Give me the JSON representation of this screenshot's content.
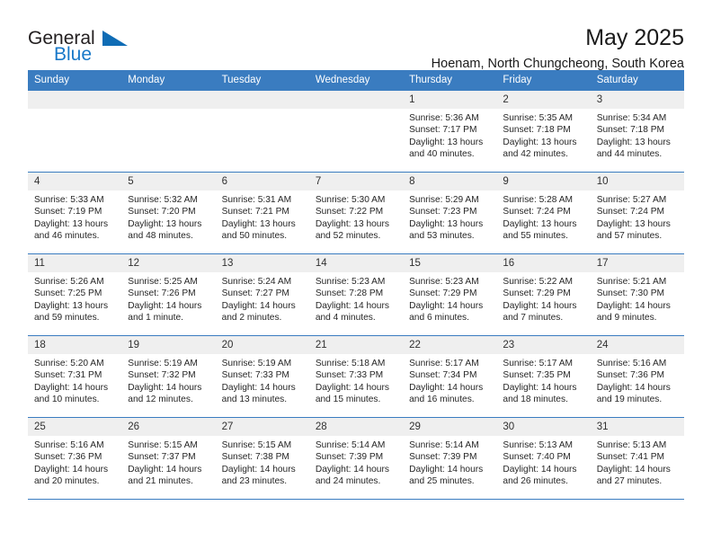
{
  "brand": {
    "name_top": "General",
    "name_bottom": "Blue",
    "accent_color": "#1878c8",
    "triangle_color": "#0f6cb5"
  },
  "header": {
    "title": "May 2025",
    "subtitle": "Hoenam, North Chungcheong, South Korea"
  },
  "calendar": {
    "header_bg": "#3a7cc0",
    "daynum_bg": "#efefef",
    "weekday_labels": [
      "Sunday",
      "Monday",
      "Tuesday",
      "Wednesday",
      "Thursday",
      "Friday",
      "Saturday"
    ],
    "weeks": [
      [
        {
          "day": "",
          "lines": []
        },
        {
          "day": "",
          "lines": []
        },
        {
          "day": "",
          "lines": []
        },
        {
          "day": "",
          "lines": []
        },
        {
          "day": "1",
          "lines": [
            "Sunrise: 5:36 AM",
            "Sunset: 7:17 PM",
            "Daylight: 13 hours",
            "and 40 minutes."
          ]
        },
        {
          "day": "2",
          "lines": [
            "Sunrise: 5:35 AM",
            "Sunset: 7:18 PM",
            "Daylight: 13 hours",
            "and 42 minutes."
          ]
        },
        {
          "day": "3",
          "lines": [
            "Sunrise: 5:34 AM",
            "Sunset: 7:18 PM",
            "Daylight: 13 hours",
            "and 44 minutes."
          ]
        }
      ],
      [
        {
          "day": "4",
          "lines": [
            "Sunrise: 5:33 AM",
            "Sunset: 7:19 PM",
            "Daylight: 13 hours",
            "and 46 minutes."
          ]
        },
        {
          "day": "5",
          "lines": [
            "Sunrise: 5:32 AM",
            "Sunset: 7:20 PM",
            "Daylight: 13 hours",
            "and 48 minutes."
          ]
        },
        {
          "day": "6",
          "lines": [
            "Sunrise: 5:31 AM",
            "Sunset: 7:21 PM",
            "Daylight: 13 hours",
            "and 50 minutes."
          ]
        },
        {
          "day": "7",
          "lines": [
            "Sunrise: 5:30 AM",
            "Sunset: 7:22 PM",
            "Daylight: 13 hours",
            "and 52 minutes."
          ]
        },
        {
          "day": "8",
          "lines": [
            "Sunrise: 5:29 AM",
            "Sunset: 7:23 PM",
            "Daylight: 13 hours",
            "and 53 minutes."
          ]
        },
        {
          "day": "9",
          "lines": [
            "Sunrise: 5:28 AM",
            "Sunset: 7:24 PM",
            "Daylight: 13 hours",
            "and 55 minutes."
          ]
        },
        {
          "day": "10",
          "lines": [
            "Sunrise: 5:27 AM",
            "Sunset: 7:24 PM",
            "Daylight: 13 hours",
            "and 57 minutes."
          ]
        }
      ],
      [
        {
          "day": "11",
          "lines": [
            "Sunrise: 5:26 AM",
            "Sunset: 7:25 PM",
            "Daylight: 13 hours",
            "and 59 minutes."
          ]
        },
        {
          "day": "12",
          "lines": [
            "Sunrise: 5:25 AM",
            "Sunset: 7:26 PM",
            "Daylight: 14 hours",
            "and 1 minute."
          ]
        },
        {
          "day": "13",
          "lines": [
            "Sunrise: 5:24 AM",
            "Sunset: 7:27 PM",
            "Daylight: 14 hours",
            "and 2 minutes."
          ]
        },
        {
          "day": "14",
          "lines": [
            "Sunrise: 5:23 AM",
            "Sunset: 7:28 PM",
            "Daylight: 14 hours",
            "and 4 minutes."
          ]
        },
        {
          "day": "15",
          "lines": [
            "Sunrise: 5:23 AM",
            "Sunset: 7:29 PM",
            "Daylight: 14 hours",
            "and 6 minutes."
          ]
        },
        {
          "day": "16",
          "lines": [
            "Sunrise: 5:22 AM",
            "Sunset: 7:29 PM",
            "Daylight: 14 hours",
            "and 7 minutes."
          ]
        },
        {
          "day": "17",
          "lines": [
            "Sunrise: 5:21 AM",
            "Sunset: 7:30 PM",
            "Daylight: 14 hours",
            "and 9 minutes."
          ]
        }
      ],
      [
        {
          "day": "18",
          "lines": [
            "Sunrise: 5:20 AM",
            "Sunset: 7:31 PM",
            "Daylight: 14 hours",
            "and 10 minutes."
          ]
        },
        {
          "day": "19",
          "lines": [
            "Sunrise: 5:19 AM",
            "Sunset: 7:32 PM",
            "Daylight: 14 hours",
            "and 12 minutes."
          ]
        },
        {
          "day": "20",
          "lines": [
            "Sunrise: 5:19 AM",
            "Sunset: 7:33 PM",
            "Daylight: 14 hours",
            "and 13 minutes."
          ]
        },
        {
          "day": "21",
          "lines": [
            "Sunrise: 5:18 AM",
            "Sunset: 7:33 PM",
            "Daylight: 14 hours",
            "and 15 minutes."
          ]
        },
        {
          "day": "22",
          "lines": [
            "Sunrise: 5:17 AM",
            "Sunset: 7:34 PM",
            "Daylight: 14 hours",
            "and 16 minutes."
          ]
        },
        {
          "day": "23",
          "lines": [
            "Sunrise: 5:17 AM",
            "Sunset: 7:35 PM",
            "Daylight: 14 hours",
            "and 18 minutes."
          ]
        },
        {
          "day": "24",
          "lines": [
            "Sunrise: 5:16 AM",
            "Sunset: 7:36 PM",
            "Daylight: 14 hours",
            "and 19 minutes."
          ]
        }
      ],
      [
        {
          "day": "25",
          "lines": [
            "Sunrise: 5:16 AM",
            "Sunset: 7:36 PM",
            "Daylight: 14 hours",
            "and 20 minutes."
          ]
        },
        {
          "day": "26",
          "lines": [
            "Sunrise: 5:15 AM",
            "Sunset: 7:37 PM",
            "Daylight: 14 hours",
            "and 21 minutes."
          ]
        },
        {
          "day": "27",
          "lines": [
            "Sunrise: 5:15 AM",
            "Sunset: 7:38 PM",
            "Daylight: 14 hours",
            "and 23 minutes."
          ]
        },
        {
          "day": "28",
          "lines": [
            "Sunrise: 5:14 AM",
            "Sunset: 7:39 PM",
            "Daylight: 14 hours",
            "and 24 minutes."
          ]
        },
        {
          "day": "29",
          "lines": [
            "Sunrise: 5:14 AM",
            "Sunset: 7:39 PM",
            "Daylight: 14 hours",
            "and 25 minutes."
          ]
        },
        {
          "day": "30",
          "lines": [
            "Sunrise: 5:13 AM",
            "Sunset: 7:40 PM",
            "Daylight: 14 hours",
            "and 26 minutes."
          ]
        },
        {
          "day": "31",
          "lines": [
            "Sunrise: 5:13 AM",
            "Sunset: 7:41 PM",
            "Daylight: 14 hours",
            "and 27 minutes."
          ]
        }
      ]
    ]
  }
}
